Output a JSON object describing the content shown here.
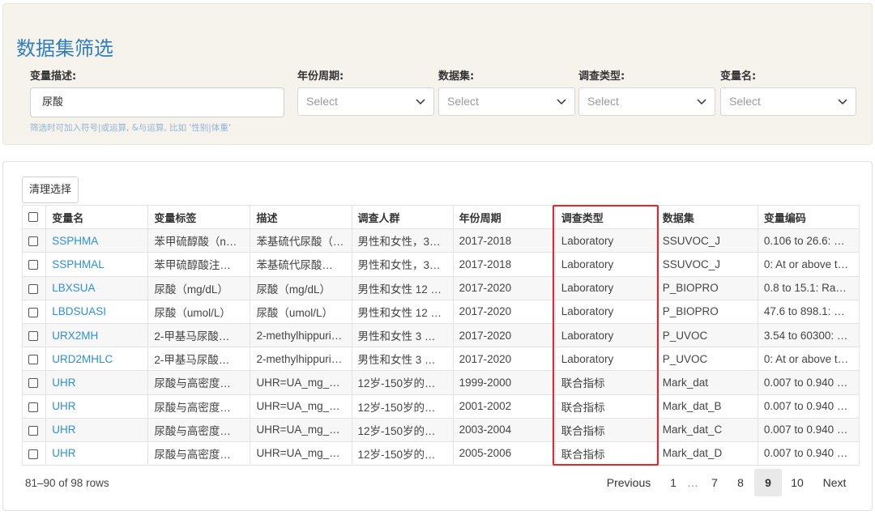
{
  "filter": {
    "title": "数据集筛选",
    "labels": {
      "variable_desc": "变量描述:",
      "year_period": "年份周期:",
      "dataset": "数据集:",
      "survey_type": "调查类型:",
      "variable_name": "变量名:"
    },
    "search_value": "尿酸",
    "hint": "筛选时可加入符号|或运算, &与运算, 比如 '性别|体重'",
    "selects": {
      "year_period": "Select",
      "dataset": "Select",
      "survey_type": "Select",
      "variable_name": "Select"
    }
  },
  "toolbar": {
    "clear_label": "清理选择"
  },
  "table": {
    "headers": [
      "变量名",
      "变量标签",
      "描述",
      "调查人群",
      "年份周期",
      "调查类型",
      "数据集",
      "变量编码"
    ],
    "rows": [
      [
        "SSPHMA",
        "苯甲硫醇酸（n…",
        "苯基硫代尿酸（…",
        "男性和女性，3…",
        "2017-2018",
        "Laboratory",
        "SSUVOC_J",
        "0.106 to 26.6: …"
      ],
      [
        "SSPHMAL",
        "苯甲硫醇酸注…",
        "苯基硫代尿酸…",
        "男性和女性，3…",
        "2017-2018",
        "Laboratory",
        "SSUVOC_J",
        "0: At or above t…"
      ],
      [
        "LBXSUA",
        "尿酸（mg/dL）",
        "尿酸（mg/dL）",
        "男性和女性 12 …",
        "2017-2020",
        "Laboratory",
        "P_BIOPRO",
        "0.8 to 15.1: Ra…"
      ],
      [
        "LBDSUASI",
        "尿酸（umol/L）",
        "尿酸（umol/L）",
        "男性和女性 12 …",
        "2017-2020",
        "Laboratory",
        "P_BIOPRO",
        "47.6 to 898.1: …"
      ],
      [
        "URX2MH",
        "2-甲基马尿酸…",
        "2-methylhippuri…",
        "男性和女性 3 …",
        "2017-2020",
        "Laboratory",
        "P_UVOC",
        "3.54 to 60300: …"
      ],
      [
        "URD2MHLC",
        "2-甲基马尿酸…",
        "2-methylhippuri…",
        "男性和女性 3 …",
        "2017-2020",
        "Laboratory",
        "P_UVOC",
        "0: At or above t…"
      ],
      [
        "UHR",
        "尿酸与高密度…",
        "UHR=UA_mg_…",
        "12岁-150岁的…",
        "1999-2000",
        "联合指标",
        "Mark_dat",
        "0.007 to 0.940 …"
      ],
      [
        "UHR",
        "尿酸与高密度…",
        "UHR=UA_mg_…",
        "12岁-150岁的…",
        "2001-2002",
        "联合指标",
        "Mark_dat_B",
        "0.007 to 0.940 …"
      ],
      [
        "UHR",
        "尿酸与高密度…",
        "UHR=UA_mg_…",
        "12岁-150岁的…",
        "2003-2004",
        "联合指标",
        "Mark_dat_C",
        "0.007 to 0.940 …"
      ],
      [
        "UHR",
        "尿酸与高密度…",
        "UHR=UA_mg_…",
        "12岁-150岁的…",
        "2005-2006",
        "联合指标",
        "Mark_dat_D",
        "0.007 to 0.940 …"
      ]
    ]
  },
  "footer": {
    "rows_info": "81–90 of 98 rows",
    "pagination": {
      "previous": "Previous",
      "pages": [
        "1",
        "…",
        "7",
        "8",
        "9",
        "10"
      ],
      "active": "9",
      "next": "Next"
    }
  },
  "colors": {
    "accent": "#2f7ec1",
    "link": "#2f8fd6",
    "highlight_border": "#e8262b",
    "panel_bg": "#f6f3ec"
  },
  "icons": {
    "select_arrow": "chevron-down-icon"
  }
}
